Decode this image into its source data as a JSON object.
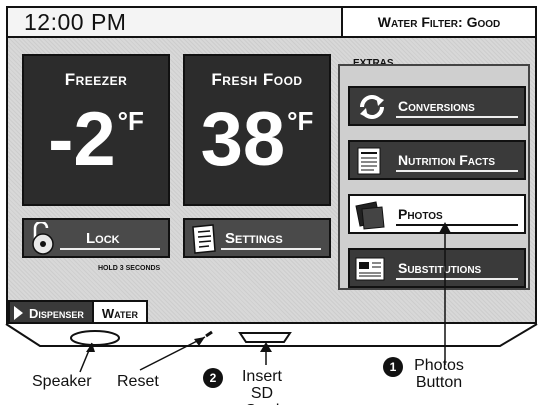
{
  "status_bar": {
    "time": "12:00 PM",
    "water_filter": "Water Filter: Good"
  },
  "freezer": {
    "title": "Freezer",
    "temp": "-2",
    "unit": "°F"
  },
  "fresh_food": {
    "title": "Fresh Food",
    "temp": "38",
    "unit": "°F"
  },
  "lock": {
    "label": "Lock",
    "hint": "HOLD 3 SECONDS"
  },
  "settings": {
    "label": "Settings"
  },
  "extras": {
    "heading": "EXTRAS",
    "items": [
      {
        "label": "Conversions",
        "icon": "conversions-icon"
      },
      {
        "label": "Nutrition Facts",
        "icon": "nutrition-icon"
      },
      {
        "label": "Photos",
        "icon": "photos-icon"
      },
      {
        "label": "Substitutions",
        "icon": "substitutions-icon"
      }
    ]
  },
  "dispenser": {
    "label": "Dispenser",
    "mode": "Water"
  },
  "callouts": {
    "speaker": "Speaker",
    "reset": "Reset",
    "insert_sd_num": "2",
    "insert_sd": "Insert SD Card",
    "photos_num": "1",
    "photos_button": "Photos Button"
  }
}
